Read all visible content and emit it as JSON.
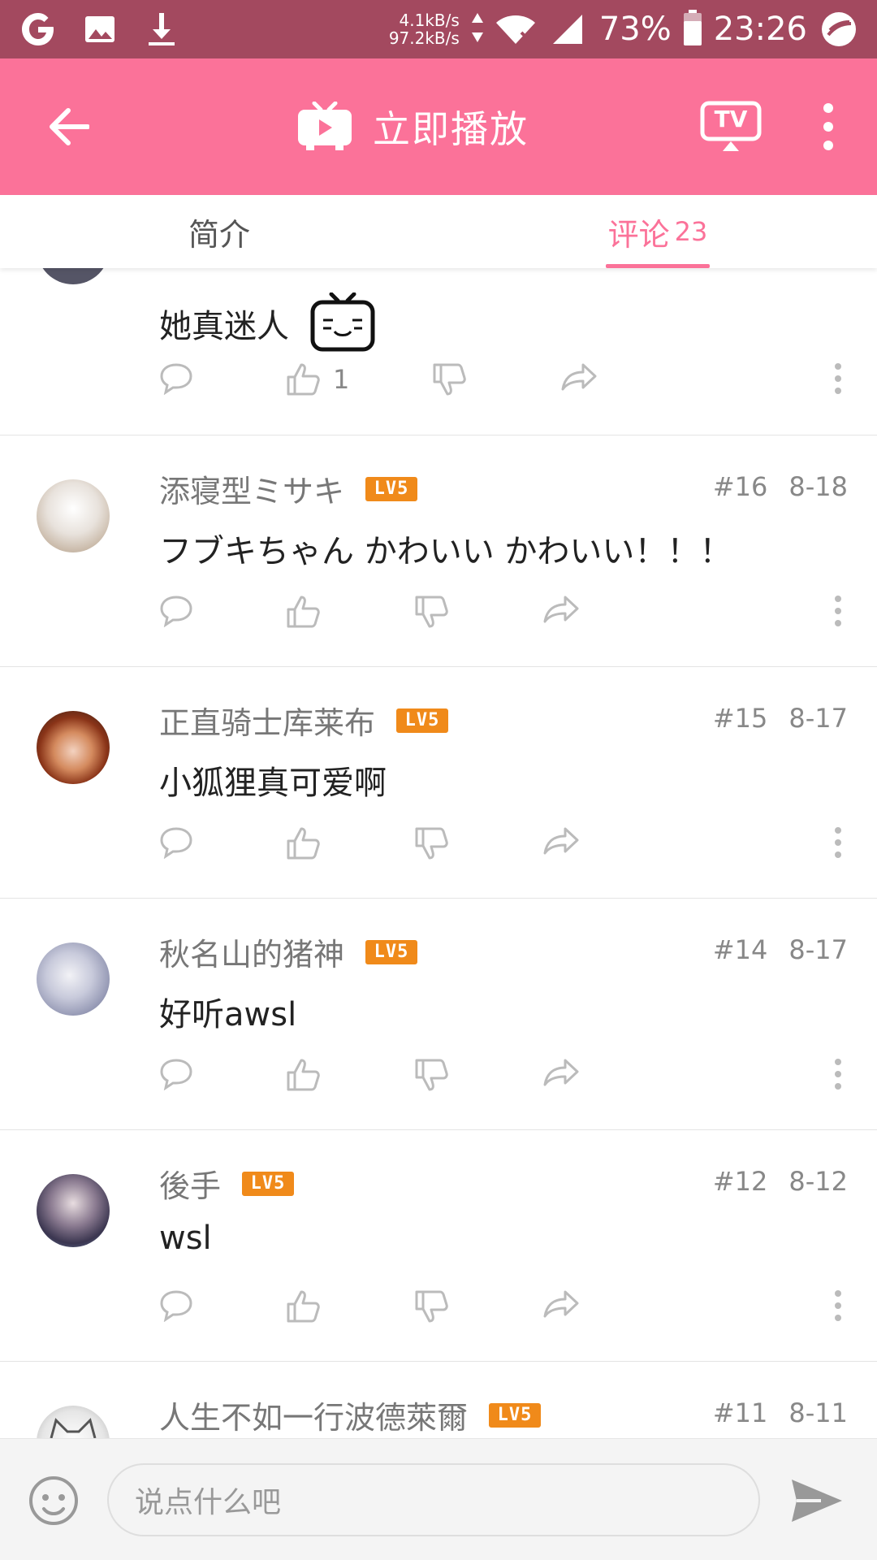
{
  "status_bar": {
    "net_up": "4.1kB/s",
    "net_down": "97.2kB/s",
    "battery": "73%",
    "time": "23:26"
  },
  "app_bar": {
    "title": "立即播放",
    "tv_label": "TV",
    "bg_color": "#fb7299"
  },
  "tabs": [
    {
      "label": "简介",
      "count": ""
    },
    {
      "label": "评论",
      "count": "23"
    }
  ],
  "comments": [
    {
      "username": "",
      "level": "",
      "floor": "",
      "date": "",
      "text": "她真迷人",
      "likes": "1",
      "has_emote": true
    },
    {
      "username": "添寝型ミサキ",
      "level": "LV5",
      "floor": "#16",
      "date": "8-18",
      "text": "フブキちゃん かわいい かわいい！！！",
      "likes": ""
    },
    {
      "username": "正直骑士库莱布",
      "level": "LV5",
      "floor": "#15",
      "date": "8-17",
      "text": "小狐狸真可爱啊",
      "likes": ""
    },
    {
      "username": "秋名山的猪神",
      "level": "LV5",
      "floor": "#14",
      "date": "8-17",
      "text": "好听awsl",
      "likes": ""
    },
    {
      "username": "後手",
      "level": "LV5",
      "floor": "#12",
      "date": "8-12",
      "text": "wsl",
      "likes": ""
    },
    {
      "username": "人生不如一行波德萊爾",
      "level": "LV5",
      "floor": "#11",
      "date": "8-11",
      "text": "",
      "likes": ""
    }
  ],
  "input": {
    "placeholder": "说点什么吧"
  },
  "icons": {
    "status": [
      "google-icon",
      "image-icon",
      "download-icon",
      "wifi-icon",
      "signal-icon",
      "battery-icon",
      "app-icon"
    ],
    "comment_actions": [
      "reply-icon",
      "like-icon",
      "dislike-icon",
      "share-icon",
      "more-icon"
    ]
  }
}
